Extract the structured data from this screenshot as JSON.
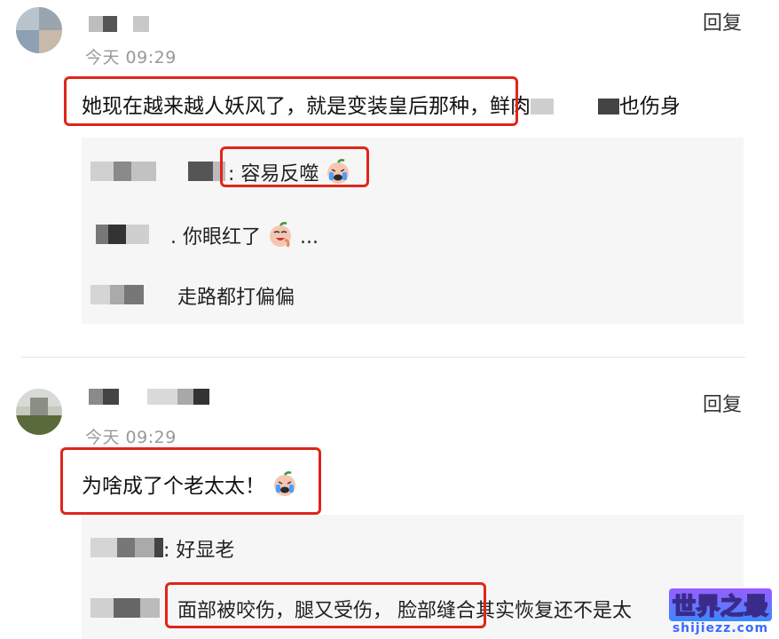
{
  "comments": [
    {
      "reply_label": "回复",
      "time": "今天 09:29",
      "text": "她现在越来越人妖风了，就是变装皇后那种，鲜肉",
      "text_tail": "也伤身",
      "replies": [
        {
          "text": ": 容易反噬",
          "emoji": "crying-face"
        },
        {
          "text": ". 你眼红了",
          "suffix": "...",
          "emoji": "laughing-face"
        },
        {
          "text": "走路都打偏偏"
        }
      ]
    },
    {
      "reply_label": "回复",
      "time": "今天 09:29",
      "text": "为啥成了个老太太！",
      "emoji": "crying-face",
      "replies": [
        {
          "text": ": 好显老"
        },
        {
          "text": "面部被咬伤，腿又受伤，",
          "text_tail": "脸部缝合其实恢复还不是太"
        }
      ]
    }
  ],
  "watermark": {
    "cn": "世界之最",
    "en": "shijiezz.com"
  },
  "colors": {
    "highlight": "#e0251b",
    "thread_bg": "#f6f6f6",
    "time": "#999999"
  }
}
